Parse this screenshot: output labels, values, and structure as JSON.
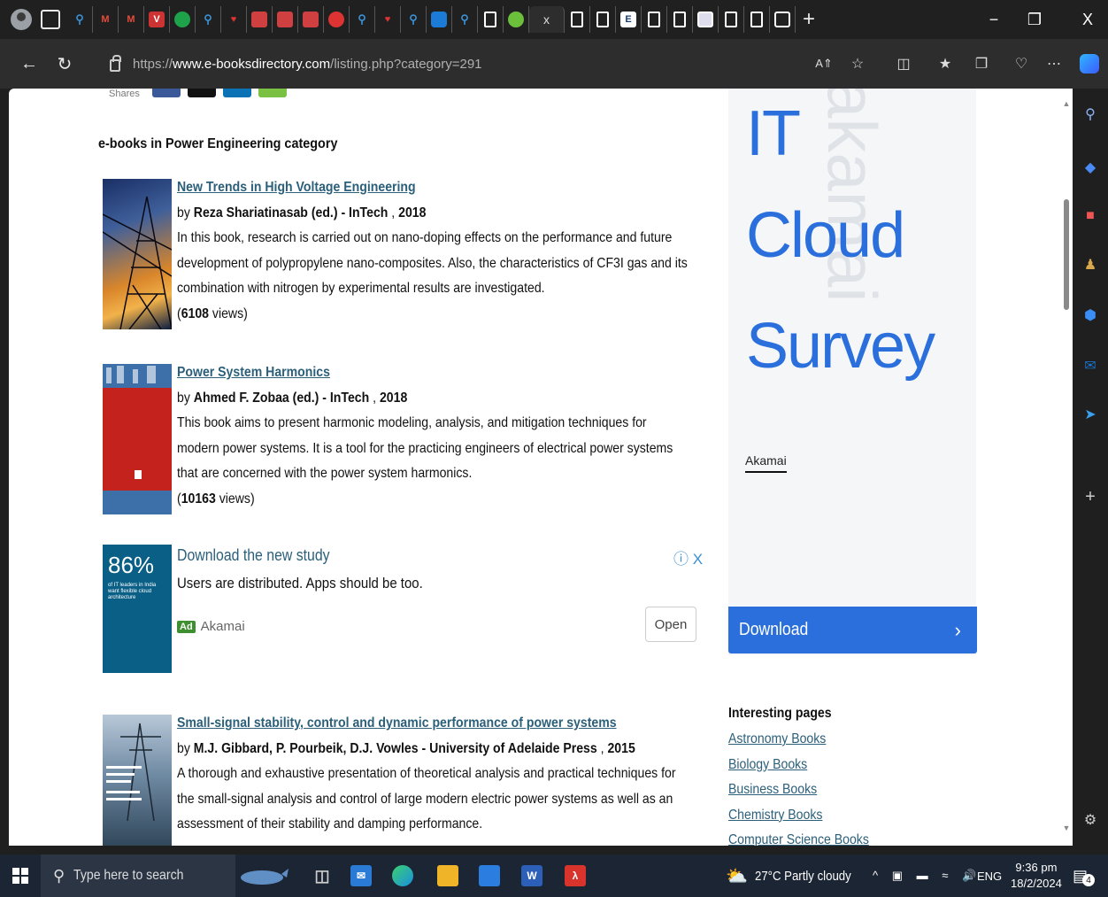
{
  "browser": {
    "tab_close": "x",
    "new_tab": "+",
    "url_prefix": "https://",
    "url_domain": "www.e-booksdirectory.com",
    "url_path": "/listing.php?category=291",
    "window_controls": {
      "minimize": "−",
      "restore": "❐",
      "close": "X"
    }
  },
  "page": {
    "shares_label": "Shares",
    "category_heading": "e-books in Power Engineering category",
    "books": [
      {
        "title": "New Trends in High Voltage Engineering",
        "by": "by ",
        "author": "Reza Shariatinasab (ed.) - InTech",
        "sep": " , ",
        "year": "2018",
        "description_lines": [
          "In this book, research is carried out on nano-doping effects on the performance and future",
          "development of polypropylene nano-composites. Also, the characteristics of CF3I gas and its",
          "combination with nitrogen by experimental results are investigated."
        ],
        "views_count": "6108",
        "views_label": " views)"
      },
      {
        "title": "Power System Harmonics",
        "by": "by ",
        "author": "Ahmed F. Zobaa (ed.) - InTech",
        "sep": " , ",
        "year": "2018",
        "description_lines": [
          "This book aims to present harmonic modeling, analysis, and mitigation techniques for",
          "modern power systems. It is a tool for the practicing engineers of electrical power systems",
          "that are concerned with the power system harmonics."
        ],
        "views_count": "10163",
        "views_label": " views)"
      },
      {
        "title": "Small-signal stability, control and dynamic performance of power systems",
        "by": "by ",
        "author": "M.J. Gibbard, P. Pourbeik, D.J. Vowles - University of Adelaide Press",
        "sep": " , ",
        "year": "2015",
        "description_lines": [
          "A thorough and exhaustive presentation of theoretical analysis and practical techniques for",
          "the small-signal analysis and control of large modern electric power systems as well as an",
          "assessment of their stability and damping performance."
        ]
      }
    ],
    "inline_ad": {
      "title": "Download the new study",
      "description": "Users are distributed. Apps should be too.",
      "ad_tag": "Ad",
      "advertiser": "Akamai",
      "open_label": "Open",
      "info_close": "ⓘ X",
      "cover_big": "86%",
      "cover_small": "of IT leaders in India want flexible cloud architecture"
    },
    "side_ad": {
      "line1": "IT",
      "line2": "Cloud",
      "line3": "Survey",
      "ghost_text": "akamai",
      "brand_label": "Akamai",
      "download_label": "Download",
      "chevron": "›"
    },
    "interesting_pages": {
      "heading": "Interesting pages",
      "links": [
        "Astronomy Books",
        "Biology Books",
        "Business Books",
        "Chemistry Books",
        "Computer Science Books"
      ]
    }
  },
  "taskbar": {
    "search_placeholder": "Type here to search",
    "weather": "27°C  Partly cloudy",
    "language": "ENG",
    "time": "9:36 pm",
    "date": "18/2/2024",
    "notification_count": "4"
  },
  "colors": {
    "link": "#2b5f7a",
    "accent_blue": "#2a6fdb",
    "chrome_dark": "#202020",
    "taskbar": "#1c2533"
  }
}
